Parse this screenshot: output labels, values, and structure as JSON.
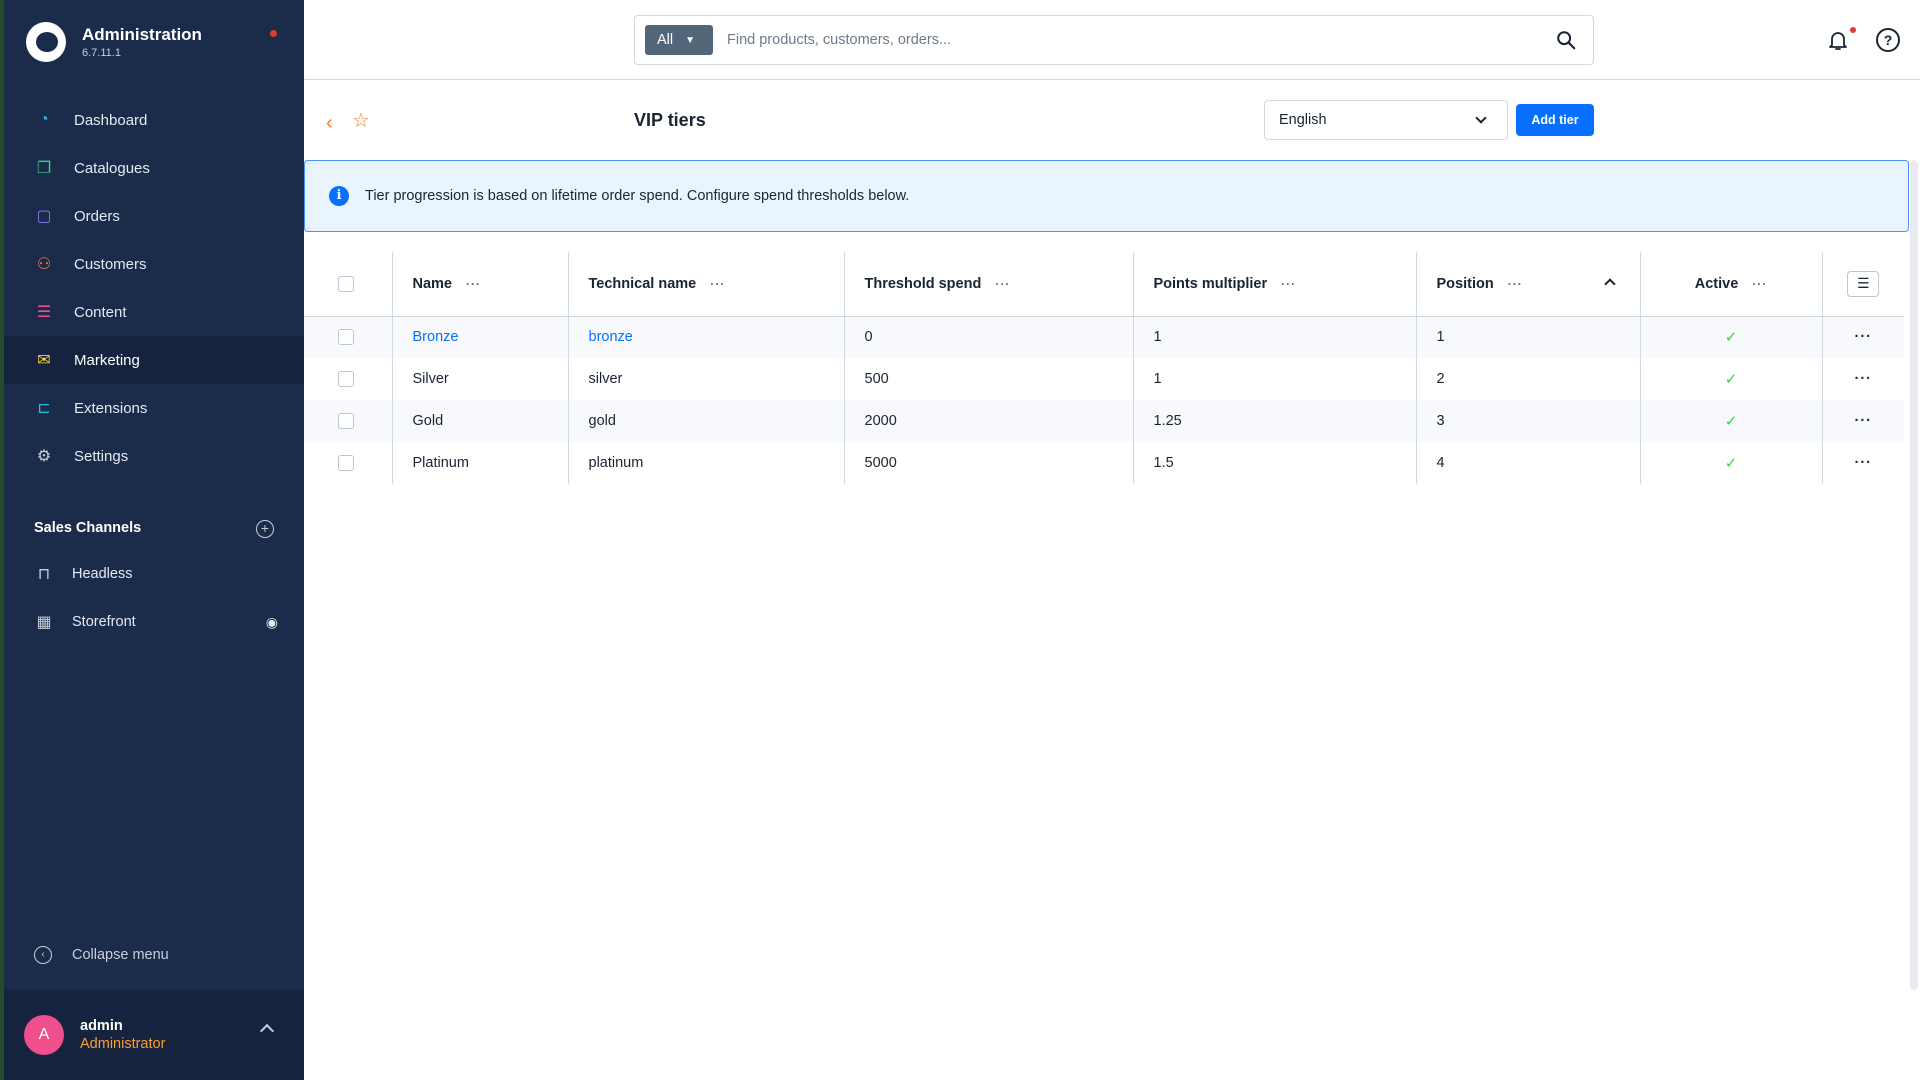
{
  "app": {
    "title": "Administration",
    "version": "6.7.11.1"
  },
  "nav": {
    "items": [
      {
        "label": "Dashboard",
        "icon": "dashboard-icon",
        "color": "#2bb7e6",
        "glyph": "◔"
      },
      {
        "label": "Catalogues",
        "icon": "catalogue-icon",
        "color": "#3ed08a",
        "glyph": "❐"
      },
      {
        "label": "Orders",
        "icon": "orders-icon",
        "color": "#8d7bf0",
        "glyph": "▢"
      },
      {
        "label": "Customers",
        "icon": "customers-icon",
        "color": "#ff7a45",
        "glyph": "⚇"
      },
      {
        "label": "Content",
        "icon": "content-icon",
        "color": "#ef4f8a",
        "glyph": "☰"
      },
      {
        "label": "Marketing",
        "icon": "marketing-icon",
        "color": "#ffd83a",
        "glyph": "✉"
      },
      {
        "label": "Extensions",
        "icon": "extensions-icon",
        "color": "#2bb7e6",
        "glyph": "⊏"
      },
      {
        "label": "Settings",
        "icon": "settings-icon",
        "color": "#c6cfdb",
        "glyph": "⚙"
      }
    ],
    "active": "Marketing"
  },
  "sales_channels": {
    "title": "Sales Channels",
    "items": [
      {
        "label": "Headless",
        "icon": "basket-icon"
      },
      {
        "label": "Storefront",
        "icon": "storefront-icon"
      }
    ]
  },
  "collapse_label": "Collapse menu",
  "user": {
    "initial": "A",
    "name": "admin",
    "role": "Administrator"
  },
  "search": {
    "type": "All",
    "placeholder": "Find products, customers, orders..."
  },
  "page": {
    "title": "VIP tiers",
    "language": "English",
    "add_label": "Add tier"
  },
  "alert": {
    "text": "Tier progression is based on lifetime order spend. Configure spend thresholds below."
  },
  "table": {
    "columns": [
      "Name",
      "Technical name",
      "Threshold spend",
      "Points multiplier",
      "Position",
      "Active"
    ],
    "rows": [
      {
        "name": "Bronze",
        "technical": "bronze",
        "threshold": "0",
        "multiplier": "1",
        "position": "1",
        "active": "✓"
      },
      {
        "name": "Silver",
        "technical": "silver",
        "threshold": "500",
        "multiplier": "1",
        "position": "2",
        "active": "✓"
      },
      {
        "name": "Gold",
        "technical": "gold",
        "threshold": "2000",
        "multiplier": "1.25",
        "position": "3",
        "active": "✓"
      },
      {
        "name": "Platinum",
        "technical": "platinum",
        "threshold": "5000",
        "multiplier": "1.5",
        "position": "4",
        "active": "✓"
      }
    ]
  },
  "colors": {
    "sidebar": "#1b2b4a",
    "primary": "#0870ff",
    "accent": "#ff7a1a",
    "success": "#37d046"
  }
}
